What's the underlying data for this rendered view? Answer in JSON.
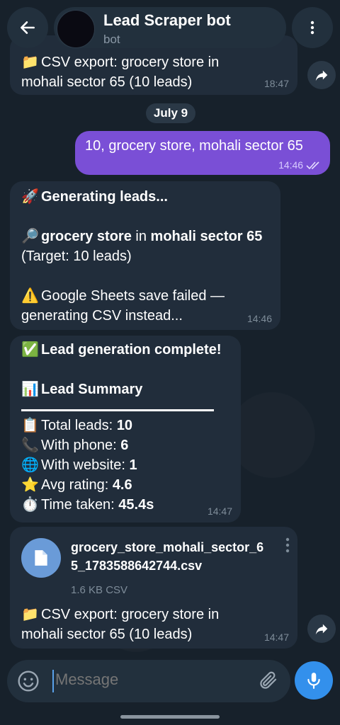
{
  "header": {
    "title": "Lead Scraper bot",
    "subtitle": "bot"
  },
  "messages": {
    "m1": {
      "emoji": "📁",
      "line1": "CSV export: grocery store in",
      "line2": "mohali sector 65 (10 leads)",
      "time": "18:47"
    },
    "date": "July 9",
    "m2": {
      "text": "10, grocery store, mohali sector 65",
      "time": "14:46"
    },
    "m3": {
      "e1": "🚀",
      "title": "Generating leads...",
      "e2": "🔎",
      "q_bold1": "grocery store",
      "q_mid": " in ",
      "q_bold2": "mohali sector 65",
      "target": "(Target: 10 leads)",
      "e3": "⚠️",
      "warn1": "Google Sheets save failed —",
      "warn2": "generating CSV instead...",
      "time": "14:46"
    },
    "m4": {
      "e1": "✅",
      "title": "Lead generation complete!",
      "e2": "📊",
      "summary_title": "Lead Summary",
      "rows": [
        {
          "emoji": "📋",
          "label": "Total leads: ",
          "value": "10"
        },
        {
          "emoji": "📞",
          "label": "With phone: ",
          "value": "6"
        },
        {
          "emoji": "🌐",
          "label": "With website: ",
          "value": "1"
        },
        {
          "emoji": "⭐",
          "label": "Avg rating: ",
          "value": "4.6"
        },
        {
          "emoji": "⏱️",
          "label": "Time taken: ",
          "value": "45.4s"
        }
      ],
      "time": "14:47"
    },
    "m5": {
      "file_name_line1": "grocery_store_mohali_sector_6",
      "file_name_line2": "5_1783588642744.csv",
      "file_size": "1.6 KB CSV",
      "emoji": "📁",
      "line1": "CSV export: grocery store in",
      "line2": "mohali sector 65 (10 leads)",
      "time": "14:47"
    }
  },
  "composer": {
    "placeholder": "Message"
  },
  "colors": {
    "background": "#17212b",
    "incoming_bubble": "#212d3b",
    "outgoing_bubble": "#7a4fd6",
    "accent": "#3390ec"
  },
  "icons": [
    "back-arrow-icon",
    "more-vertical-icon",
    "forward-icon",
    "double-check-icon",
    "file-icon",
    "emoji-icon",
    "attach-icon",
    "mic-icon"
  ]
}
